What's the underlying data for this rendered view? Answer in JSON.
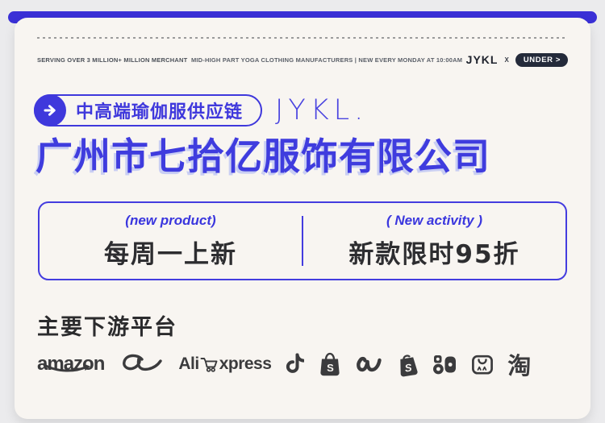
{
  "colors": {
    "accent_blue": "#3f38dc",
    "bar_blue": "#3a30d6",
    "title_blue": "#3f3cde",
    "title_shadow": "#c9cef3",
    "badge_bg": "#242a3a",
    "card_bg": "#f8f5f1",
    "page_bg": "#ebebed",
    "logo_dark": "#3b3b3d"
  },
  "header": {
    "left": "SERVING OVER 3 MILLION+ MILLION MERCHANT",
    "center": "MID-HIGH PART YOGA CLOTHING MANUFACTURERS  | NEW EVERY MONDAY AT 10:00AM",
    "brand": "JYKL",
    "times": "X",
    "badge": "UNDER >"
  },
  "hero": {
    "pill_text": "中高端瑜伽服供应链",
    "logo": "JYKL.",
    "title": "广州市七拾亿服饰有限公司"
  },
  "promo": {
    "left": {
      "tag": "(new product)",
      "text": "每周一上新"
    },
    "right": {
      "tag": "( New activity )",
      "text": "新款限时95折"
    }
  },
  "platforms": {
    "heading": "主要下游平台",
    "amazon_label": "amazon",
    "aliexpress_left": "Ali",
    "aliexpress_right": "xpress",
    "shopee_letter": "S",
    "shopify_letter": "S",
    "taobao_char": "淘",
    "names": [
      "Amazon",
      "Alibaba",
      "AliExpress",
      "TikTok",
      "Shopee",
      "Wish",
      "Shopify",
      "Kuaishou",
      "Temu",
      "Taobao"
    ]
  }
}
